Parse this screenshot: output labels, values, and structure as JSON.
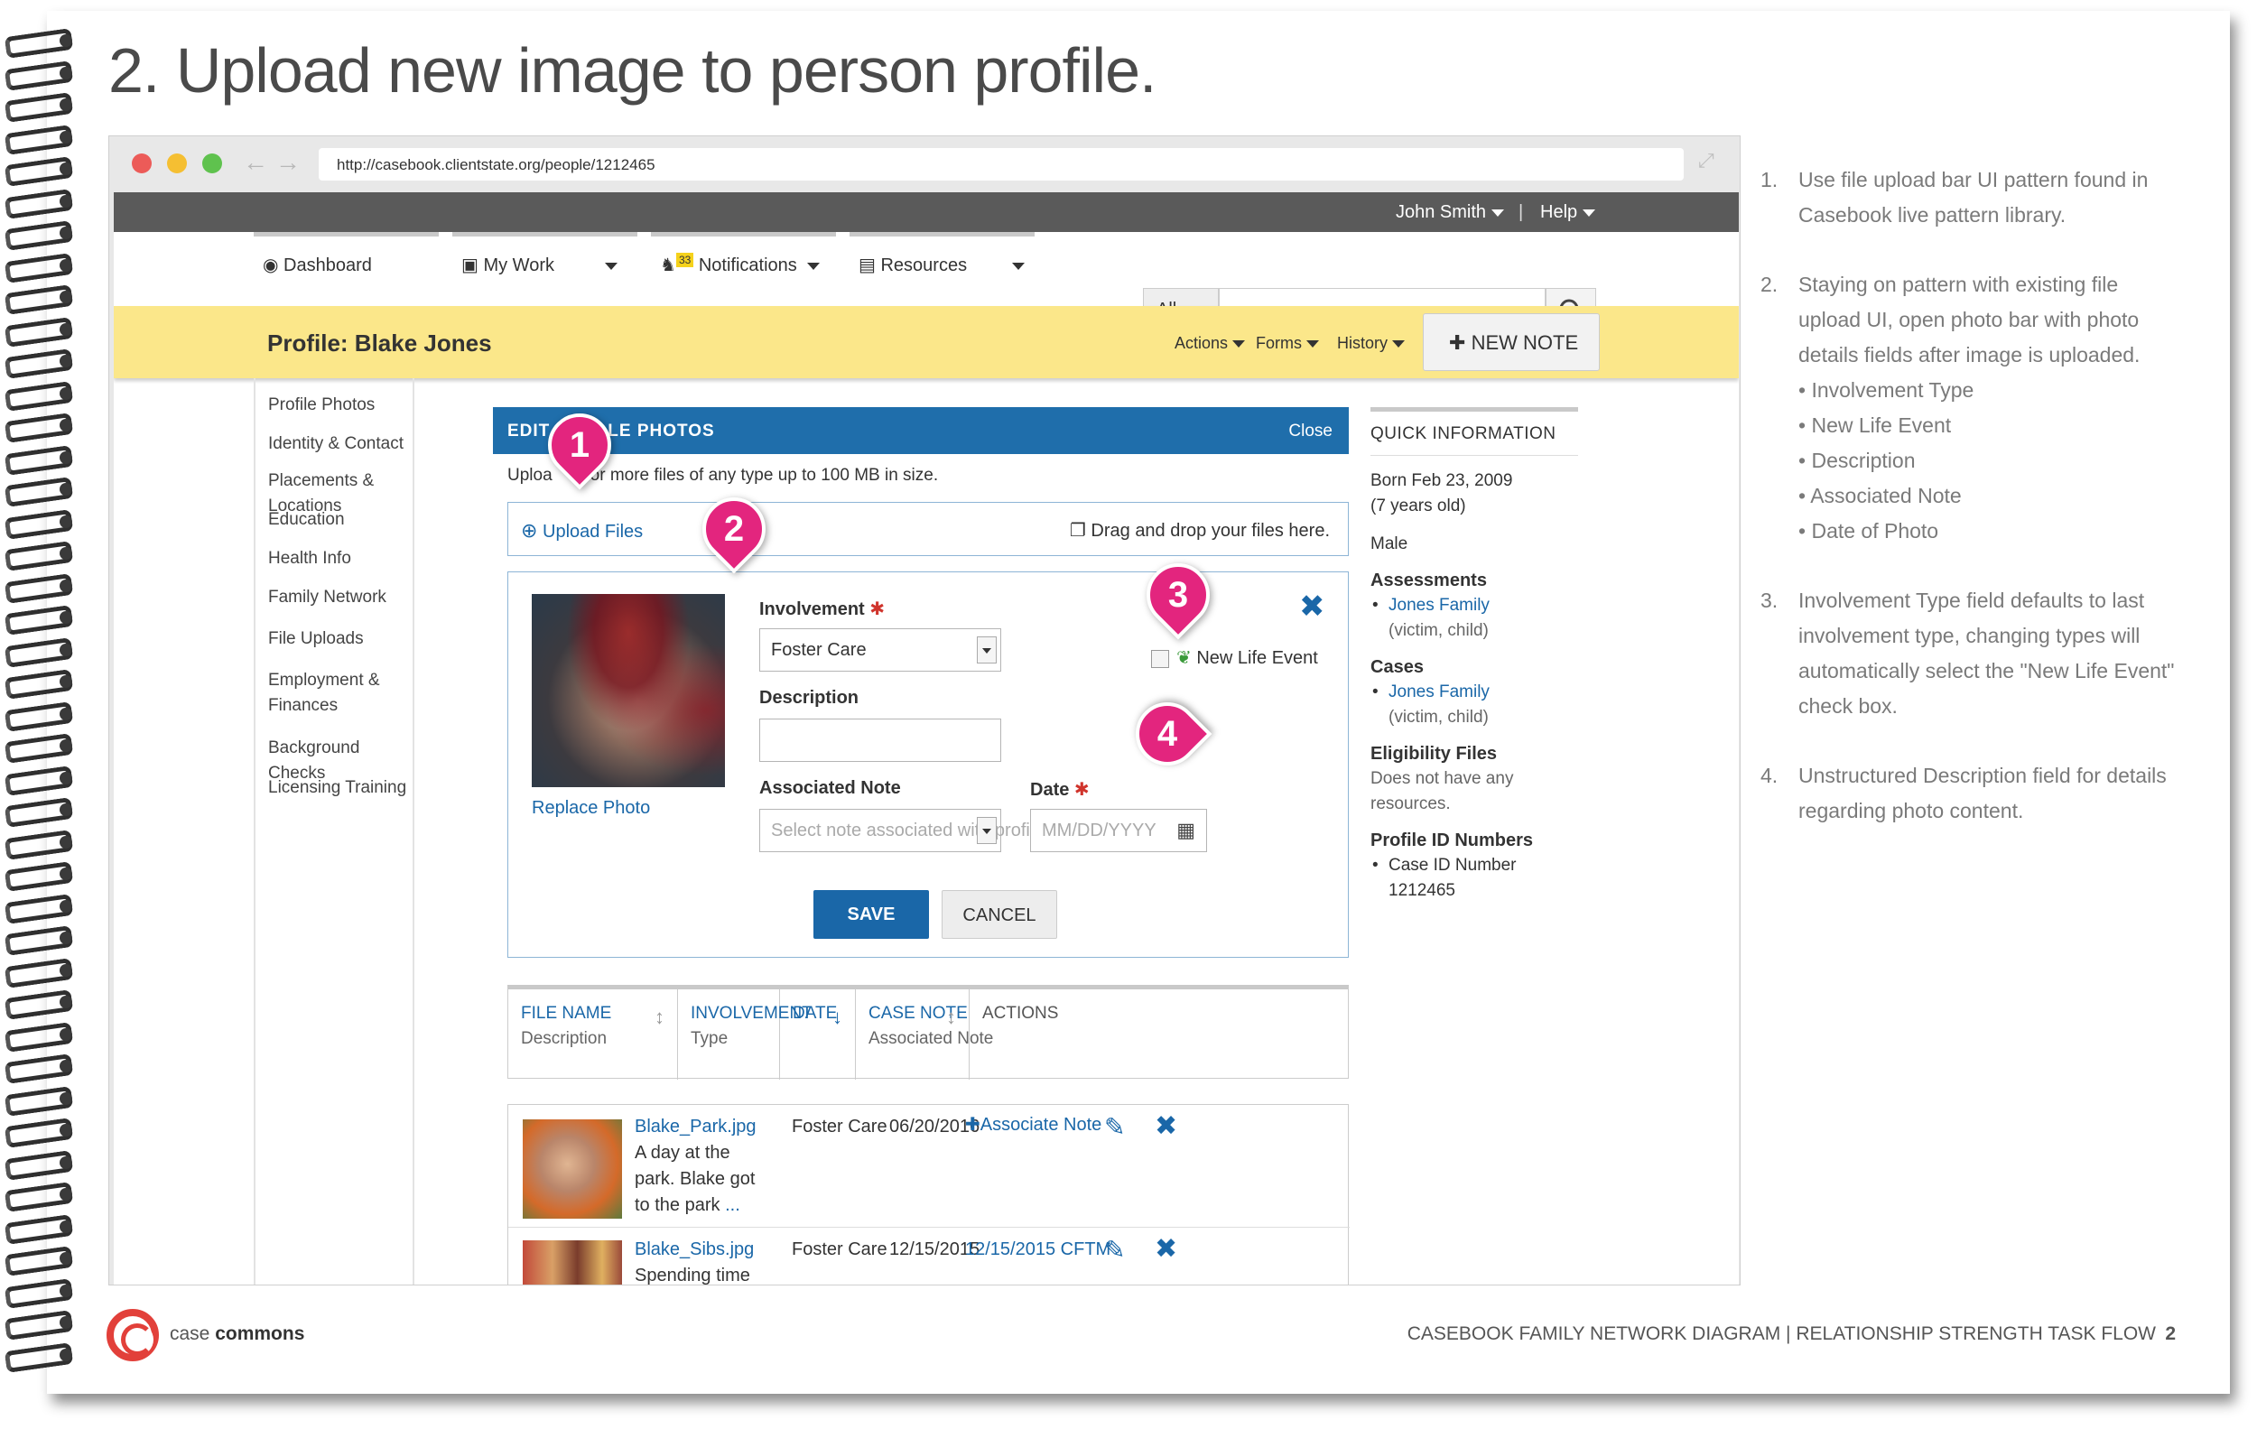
{
  "page": {
    "title": "2. Upload new image to person profile."
  },
  "browser": {
    "url": "http://casebook.clientstate.org/people/1212465"
  },
  "topbar": {
    "user": "John Smith",
    "help": "Help"
  },
  "nav": {
    "dashboard": "Dashboard",
    "my_work": "My Work",
    "notifications": "Notifications",
    "notifications_badge": "33",
    "resources": "Resources",
    "search_scope": "All"
  },
  "profile": {
    "title": "Profile: Blake Jones",
    "actions": "Actions",
    "forms": "Forms",
    "history": "History",
    "new_note": "NEW NOTE"
  },
  "sidebar": {
    "items": [
      "Profile Photos",
      "Identity & Contact",
      "Placements & Locations",
      "Education",
      "Health Info",
      "Family Network",
      "File Uploads",
      "Employment & Finances",
      "Background Checks",
      "Licensing Training"
    ]
  },
  "panel": {
    "title_left": "EDIT",
    "title_right": "LE PHOTOS",
    "close": "Close",
    "hint_left": "Uploa",
    "hint_right": "or more files of any type up to 100 MB in size.",
    "upload_files": "Upload Files",
    "drag_drop": "Drag and drop your files here.",
    "replace_photo": "Replace Photo",
    "involvement_label": "Involvement",
    "involvement_value": "Foster Care",
    "new_life_event": "New Life Event",
    "description_label": "Description",
    "description_value": "",
    "note_label": "Associated Note",
    "note_placeholder": "Select note associated with profile",
    "date_label": "Date",
    "date_placeholder": "MM/DD/YYYY",
    "save": "SAVE",
    "cancel": "CANCEL"
  },
  "table": {
    "headers": [
      {
        "t1": "FILE NAME",
        "t2": "Description"
      },
      {
        "t1": "INVOLVEMENT",
        "t2": "Type"
      },
      {
        "t1": "DATE",
        "t2": ""
      },
      {
        "t1": "CASE NOTE",
        "t2": "Associated Note"
      },
      {
        "t1": "ACTIONS",
        "t2": ""
      }
    ],
    "rows": [
      {
        "file": "Blake_Park.jpg",
        "desc_1": "A day at the",
        "desc_2": "park. Blake got",
        "desc_3": "to the park",
        "desc_more": "...",
        "involvement": "Foster Care",
        "date": "06/20/2016",
        "note": "Associate Note"
      },
      {
        "file": "Blake_Sibs.jpg",
        "desc_1": "Spending time",
        "involvement": "Foster Care",
        "date": "12/15/2015",
        "note": "12/15/2015 CFTM"
      }
    ]
  },
  "quick": {
    "title": "QUICK INFORMATION",
    "born": "Born Feb 23, 2009",
    "age": "(7 years old)",
    "sex": "Male",
    "assessments_label": "Assessments",
    "assessment_link": "Jones Family",
    "assessment_role": "(victim, child)",
    "cases_label": "Cases",
    "case_link": "Jones Family",
    "case_role": "(victim, child)",
    "eligibility_label": "Eligibility Files",
    "eligibility_text": "Does not have any resources.",
    "ids_label": "Profile ID Numbers",
    "id_line1": "Case ID Number",
    "id_line2": "1212465"
  },
  "markers": [
    "1",
    "2",
    "3",
    "4"
  ],
  "notes": {
    "n1_num": "1.",
    "n1": "Use file upload bar UI pattern found in Casebook live pattern library.",
    "n2_num": "2.",
    "n2": "Staying on pattern with existing file upload UI, open photo bar with photo details fields after image is uploaded.",
    "n2_bullets": [
      "Involvement Type",
      "New Life Event",
      "Description",
      "Associated Note",
      "Date of Photo"
    ],
    "n3_num": "3.",
    "n3": "Involvement Type field defaults to last involvement type, changing types will automatically select the \"New Life Event\" check box.",
    "n4_num": "4.",
    "n4": "Unstructured Description field for details regarding photo content."
  },
  "footer": {
    "logo_case": "case",
    "logo_commons": "commons",
    "title": "CASEBOOK FAMILY NETWORK DIAGRAM | RELATIONSHIP STRENGTH TASK FLOW",
    "page_num": "2"
  },
  "colors": {
    "accent_blue": "#1f6eab",
    "link_blue": "#1a67a8",
    "profile_yellow": "#fbe78a",
    "marker_pink": "#e3257e",
    "required_red": "#d0342c"
  }
}
